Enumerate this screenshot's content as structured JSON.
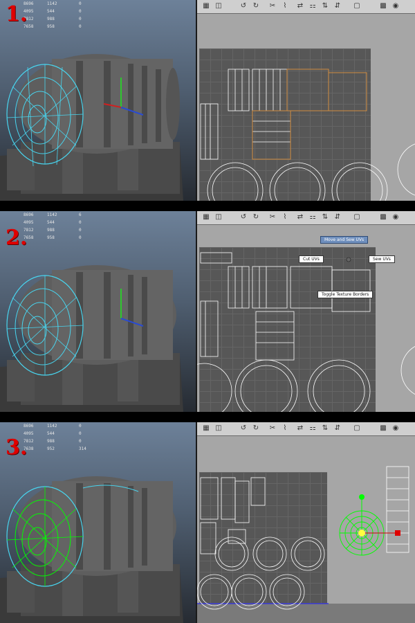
{
  "panels": [
    {
      "step": "1.",
      "stats": [
        [
          "8696",
          "1142",
          "0"
        ],
        [
          "4095",
          "544",
          "0"
        ],
        [
          "7812",
          "988",
          "0"
        ],
        [
          "7658",
          "958",
          "0"
        ]
      ],
      "marking_menu": null
    },
    {
      "step": "2.",
      "stats": [
        [
          "8696",
          "1142",
          "6"
        ],
        [
          "4095",
          "544",
          "0"
        ],
        [
          "7812",
          "988",
          "0"
        ],
        [
          "7658",
          "958",
          "0"
        ]
      ],
      "marking_menu": {
        "move_sew": "Move and Sew UVs",
        "cut": "Cut UVs",
        "sew": "Sew UVs",
        "toggle_borders": "Toggle Texture Borders"
      }
    },
    {
      "step": "3.",
      "stats": [
        [
          "8696",
          "1142",
          "0"
        ],
        [
          "4095",
          "544",
          "0"
        ],
        [
          "7812",
          "988",
          "0"
        ],
        [
          "7638",
          "952",
          "314"
        ]
      ],
      "marking_menu": null
    }
  ],
  "toolbar_icons": [
    "uv-snapshot-icon",
    "image-display-icon",
    "rotate-ccw-icon",
    "rotate-cw-icon",
    "cut-uv-icon",
    "sew-uv-icon",
    "move-sew-icon",
    "layout-icon",
    "flip-u-icon",
    "flip-v-icon",
    "texture-borders-icon",
    "checker-icon",
    "shading-icon"
  ],
  "colors": {
    "wire_selected": "#48d6f0",
    "uv_selected": "#00ff00",
    "step_label": "#e00000",
    "uv_background": "#575757"
  }
}
